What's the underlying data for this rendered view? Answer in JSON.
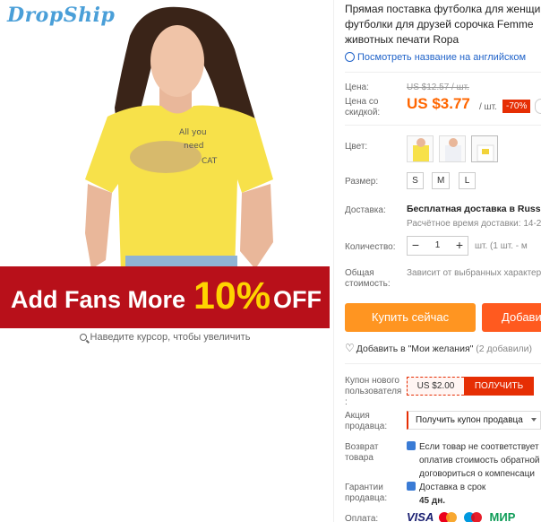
{
  "brand": "DropShip",
  "banner": {
    "text": "Add Fans More",
    "percent": "10%",
    "suffix": "OFF"
  },
  "zoom_hint": "Наведите курсор, чтобы увеличить",
  "product": {
    "title_lines": [
      "Прямая поставка футболка для женщи",
      "футболки для друзей сорочка Femme",
      "животных печати Ropa"
    ],
    "translate_link": "Посмотреть название на английском"
  },
  "price": {
    "label": "Цена:",
    "old": "US $12.57 / шт.",
    "discount_label_1": "Цена со",
    "discount_label_2": "скидкой:",
    "new": "US $3.77",
    "unit": "/ шт.",
    "discount": "-70%"
  },
  "color": {
    "label": "Цвет:",
    "options": [
      "yellow-cat",
      "white-bird",
      "white-print"
    ]
  },
  "size": {
    "label": "Размер:",
    "options": [
      "S",
      "M",
      "L"
    ]
  },
  "shipping": {
    "label": "Доставка:",
    "title": "Бесплатная доставка в Russian",
    "time": "Расчётное время доставки: 14-2"
  },
  "quantity": {
    "label": "Количество:",
    "value": "1",
    "minus": "−",
    "plus": "+",
    "note": "шт. (1 шт. - м"
  },
  "total": {
    "label_1": "Общая",
    "label_2": "стоимость:",
    "note": "Зависит от выбранных характер"
  },
  "actions": {
    "buy": "Купить сейчас",
    "cart": "Добави"
  },
  "wishlist": {
    "label": "Добавить в \"Мои желания\"",
    "count": "(2 добавили)"
  },
  "coupon": {
    "label_1": "Купон нового",
    "label_2": "пользователя",
    "label_3": ":",
    "value": "US $2.00",
    "button": "ПОЛУЧИТЬ"
  },
  "seller_promo": {
    "label_1": "Акция",
    "label_2": "продавца:",
    "select": "Получить купон продавца"
  },
  "returns": {
    "label_1": "Возврат",
    "label_2": "товара",
    "lines": [
      "Если товар не соответствует",
      "оплатив стоимость обратной",
      "договориться о компенсаци"
    ]
  },
  "guarantee": {
    "label_1": "Гарантии",
    "label_2": "продавца:",
    "line1": "Доставка в срок",
    "line2": "45 дн."
  },
  "payment": {
    "label": "Оплата:",
    "methods": [
      "VISA",
      "MasterCard",
      "Maestro",
      "МИР"
    ]
  },
  "colors": {
    "accent": "#ff9521",
    "price": "#ff6600",
    "banner": "#b8101a",
    "link": "#2063c9"
  }
}
